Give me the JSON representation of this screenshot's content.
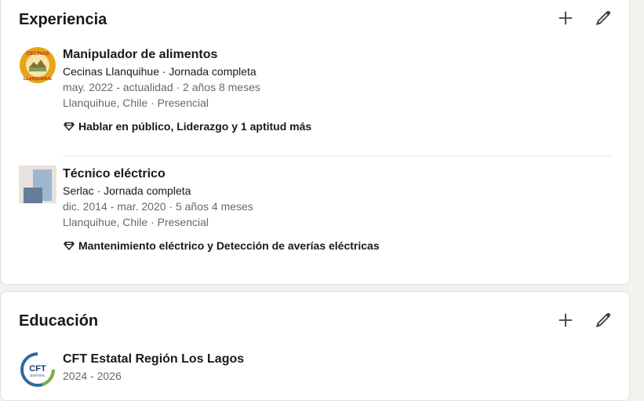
{
  "experience": {
    "title": "Experiencia",
    "add_icon": "plus-icon",
    "edit_icon": "pencil-icon",
    "items": [
      {
        "title": "Manipulador de alimentos",
        "company": "Cecinas Llanquihue · Jornada completa",
        "dates": "may. 2022 - actualidad · 2 años 8 meses",
        "location": "Llanquihue, Chile · Presencial",
        "skills": "Hablar en público, Liderazgo y 1 aptitud más",
        "logo": {
          "top_text": "CECINAS",
          "bottom_text": "LLANQUIHUE",
          "colors": {
            "ring": "#e5a51a",
            "text": "#c0271e",
            "inner": "#f7e6a6"
          }
        }
      },
      {
        "title": "Técnico eléctrico",
        "company": "Serlac · Jornada completa",
        "dates": "dic. 2014 - mar. 2020 · 5 años 4 meses",
        "location": "Llanquihue, Chile · Presencial",
        "skills": "Mantenimiento eléctrico y Detección de averías eléctricas",
        "logo": {
          "colors": {
            "bg": "#e7e2db",
            "tall": "#9eb6cf",
            "short": "#647d99"
          }
        }
      }
    ]
  },
  "education": {
    "title": "Educación",
    "add_icon": "plus-icon",
    "edit_icon": "pencil-icon",
    "items": [
      {
        "school": "CFT Estatal Región Los Lagos",
        "dates": "2024 - 2026",
        "logo": {
          "text": "CFT",
          "subtext": "ESTATAL",
          "colors": {
            "ring": "#2e6b9e",
            "accent": "#7bb244",
            "text": "#1b3f6b"
          }
        }
      }
    ]
  }
}
